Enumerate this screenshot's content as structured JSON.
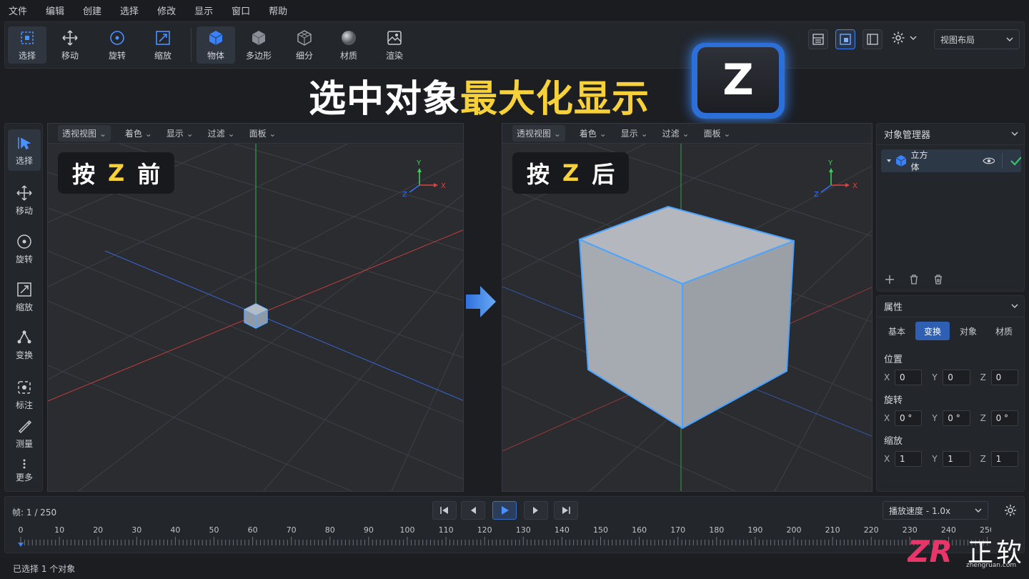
{
  "menu": [
    "文件",
    "编辑",
    "创建",
    "选择",
    "修改",
    "显示",
    "窗口",
    "帮助"
  ],
  "toolbar": {
    "tools": [
      {
        "label": "选择",
        "icon": "select-icon"
      },
      {
        "label": "移动",
        "icon": "move-icon"
      },
      {
        "label": "旋转",
        "icon": "rotate-icon"
      },
      {
        "label": "缩放",
        "icon": "scale-icon"
      },
      {
        "label": "物体",
        "icon": "cube-object-icon"
      },
      {
        "label": "多边形",
        "icon": "polygon-icon"
      },
      {
        "label": "细分",
        "icon": "subdivide-icon"
      },
      {
        "label": "材质",
        "icon": "material-sphere-icon"
      },
      {
        "label": "渲染",
        "icon": "render-icon"
      }
    ],
    "layout_select": "视图布局"
  },
  "headline": {
    "white": "选中对象",
    "yellow": "最大化显示",
    "key": "Z"
  },
  "rail": [
    {
      "label": "选择",
      "icon": "cursor-icon"
    },
    {
      "label": "移动",
      "icon": "move-icon"
    },
    {
      "label": "旋转",
      "icon": "rotate-icon"
    },
    {
      "label": "缩放",
      "icon": "scale-icon"
    },
    {
      "label": "变换",
      "icon": "transform-icon"
    },
    {
      "label": "标注",
      "icon": "annotate-icon"
    },
    {
      "label": "测量",
      "icon": "measure-icon"
    },
    {
      "label": "更多",
      "icon": "more-icon"
    }
  ],
  "viewport_menu": [
    "透视视图",
    "着色",
    "显示",
    "过滤",
    "面板"
  ],
  "viewports": {
    "left": {
      "badge_pre": "按",
      "badge_key": "Z",
      "badge_post": "前"
    },
    "right": {
      "badge_pre": "按",
      "badge_key": "Z",
      "badge_post": "后"
    }
  },
  "axes": {
    "x": "X",
    "y": "Y",
    "z": "Z"
  },
  "object_manager": {
    "title": "对象管理器",
    "objects": [
      {
        "name": "立方体"
      }
    ]
  },
  "properties": {
    "title": "属性",
    "tabs": [
      "基本",
      "变换",
      "对象",
      "材质"
    ],
    "active_tab": "变换",
    "position": {
      "label": "位置",
      "x": "0",
      "y": "0",
      "z": "0"
    },
    "rotation": {
      "label": "旋转",
      "x": "0 °",
      "y": "0 °",
      "z": "0 °"
    },
    "scale": {
      "label": "缩放",
      "x": "1",
      "y": "1",
      "z": "1"
    },
    "axis_labels": {
      "x": "X",
      "y": "Y",
      "z": "Z"
    }
  },
  "timeline": {
    "frame_label": "帧:",
    "frame_value": "1 / 250",
    "speed_label": "播放速度 - 1.0x",
    "ticks": [
      "0",
      "10",
      "20",
      "30",
      "40",
      "50",
      "60",
      "70",
      "80",
      "90",
      "100",
      "110",
      "120",
      "130",
      "140",
      "150",
      "160",
      "170",
      "180",
      "190",
      "200",
      "210",
      "220",
      "230",
      "240",
      "250"
    ]
  },
  "status": "已选择 1 个对象",
  "watermark": {
    "logo": "ZR",
    "name": "正软",
    "site": "zhengruan.com"
  },
  "colors": {
    "accent": "#3b82f6",
    "highlight": "#f7d13a",
    "axis_x": "#e04040",
    "axis_y": "#3ccf5a",
    "axis_z": "#3b6ff0"
  }
}
